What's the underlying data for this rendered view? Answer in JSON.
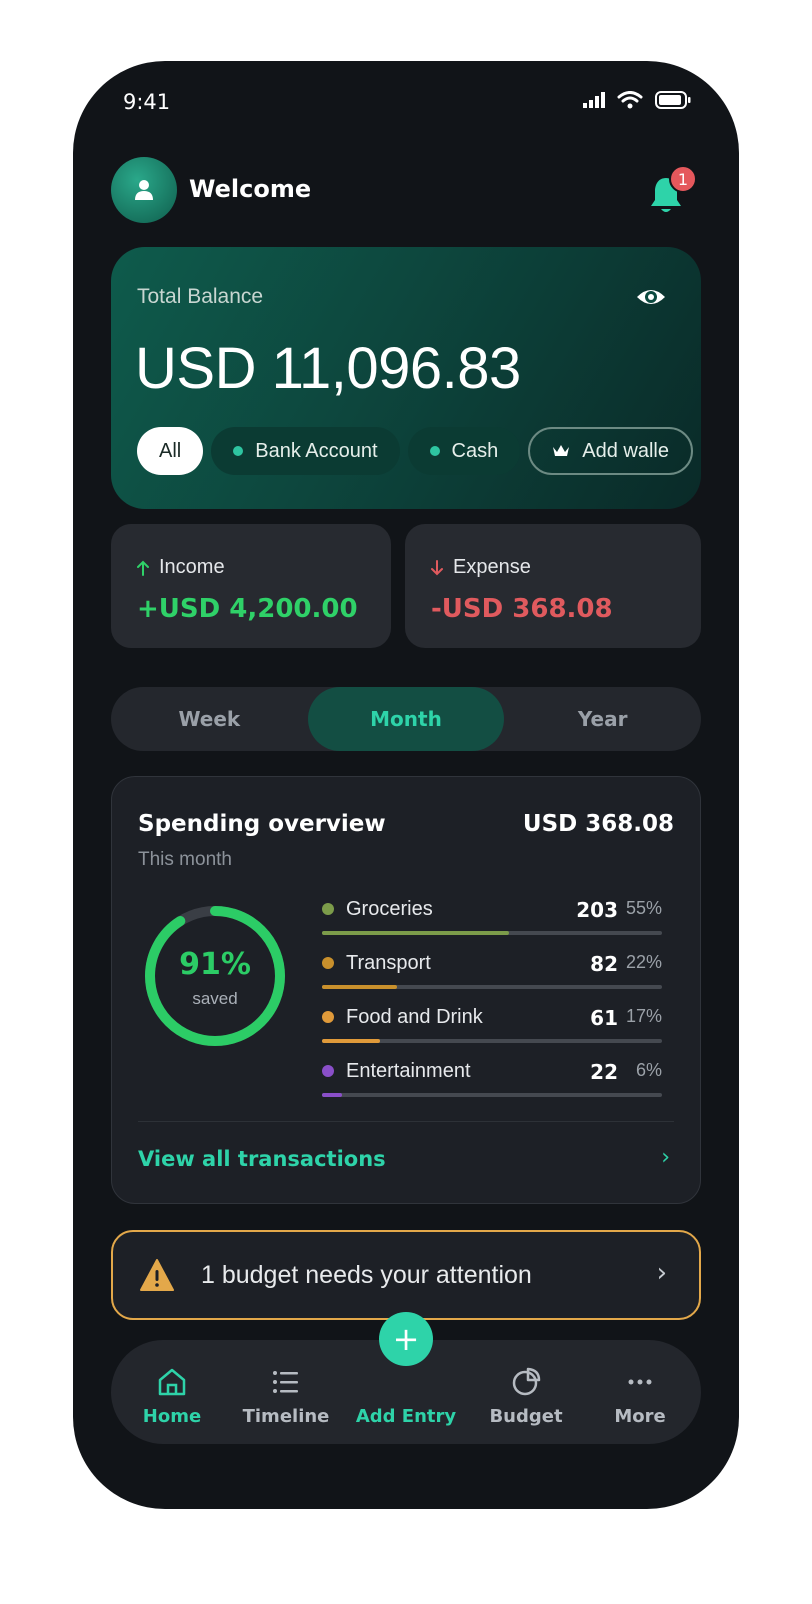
{
  "status_bar": {
    "time": "9:41"
  },
  "header": {
    "greeting": "Welcome",
    "notification_count": "1"
  },
  "balance": {
    "label": "Total Balance",
    "amount": "USD 11,096.83",
    "wallets": [
      {
        "label": "All",
        "active": true
      },
      {
        "label": "Bank Account"
      },
      {
        "label": "Cash"
      },
      {
        "label": "Add walle"
      }
    ]
  },
  "summary": {
    "income": {
      "label": "Income",
      "value": "+USD 4,200.00"
    },
    "expense": {
      "label": "Expense",
      "value": "-USD 368.08"
    }
  },
  "period_tabs": {
    "items": [
      "Week",
      "Month",
      "Year"
    ],
    "selected": "Month"
  },
  "spending": {
    "title": "Spending overview",
    "total": "USD 368.08",
    "subtitle": "This month",
    "saved_percent": "91%",
    "saved_label": "saved",
    "saved_fraction": 0.91,
    "categories": [
      {
        "name": "Groceries",
        "value": "203",
        "percent": "55%",
        "fraction": 0.55,
        "color": "#7c9c4a"
      },
      {
        "name": "Transport",
        "value": "82",
        "percent": "22%",
        "fraction": 0.22,
        "color": "#c9902c"
      },
      {
        "name": "Food and Drink",
        "value": "61",
        "percent": "17%",
        "fraction": 0.17,
        "color": "#e09a3a"
      },
      {
        "name": "Entertainment",
        "value": "22",
        "percent": "6%",
        "fraction": 0.06,
        "color": "#8a4fc9"
      }
    ],
    "view_all": "View all transactions"
  },
  "alert": {
    "text": "1 budget needs your attention"
  },
  "nav": {
    "items": [
      {
        "label": "Home",
        "icon": "home-icon",
        "active": true
      },
      {
        "label": "Timeline",
        "icon": "list-icon"
      },
      {
        "label": "Add Entry",
        "icon": "plus-icon"
      },
      {
        "label": "Budget",
        "icon": "pie-icon"
      },
      {
        "label": "More",
        "icon": "more-icon"
      }
    ]
  },
  "colors": {
    "accent": "#2ed3a9",
    "income": "#2fd168",
    "expense": "#e05a5e",
    "warning": "#e3a84a"
  }
}
